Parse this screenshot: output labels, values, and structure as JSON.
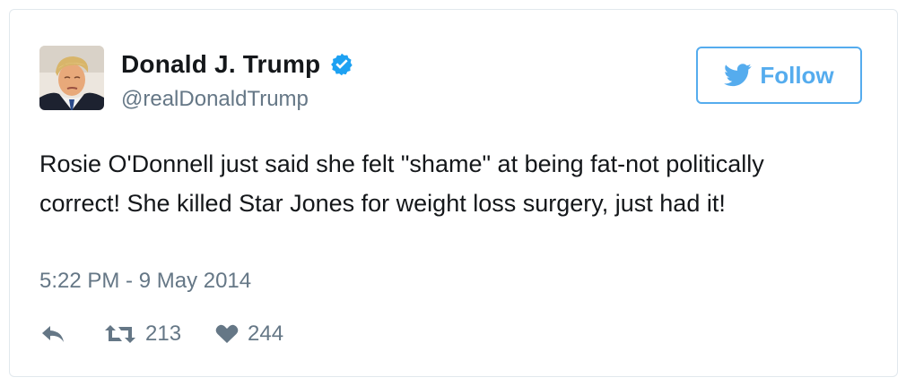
{
  "user": {
    "display_name": "Donald J. Trump",
    "handle": "@realDonaldTrump",
    "verified": true,
    "avatar_icon": "profile-photo"
  },
  "follow_button": {
    "label": "Follow",
    "icon": "twitter-bird-icon",
    "color": "#55acee"
  },
  "tweet": {
    "text": "Rosie O'Donnell just said she felt \"shame\" at being fat-not politically correct! She killed Star Jones for weight loss surgery, just had it!",
    "timestamp": "5:22 PM - 9 May 2014"
  },
  "actions": {
    "reply_icon": "reply-icon",
    "retweet_icon": "retweet-icon",
    "retweet_count": "213",
    "like_icon": "heart-icon",
    "like_count": "244"
  },
  "colors": {
    "text_primary": "#14171a",
    "text_secondary": "#657786",
    "border": "#e1e8ed",
    "verified_badge": "#1da1f2"
  }
}
